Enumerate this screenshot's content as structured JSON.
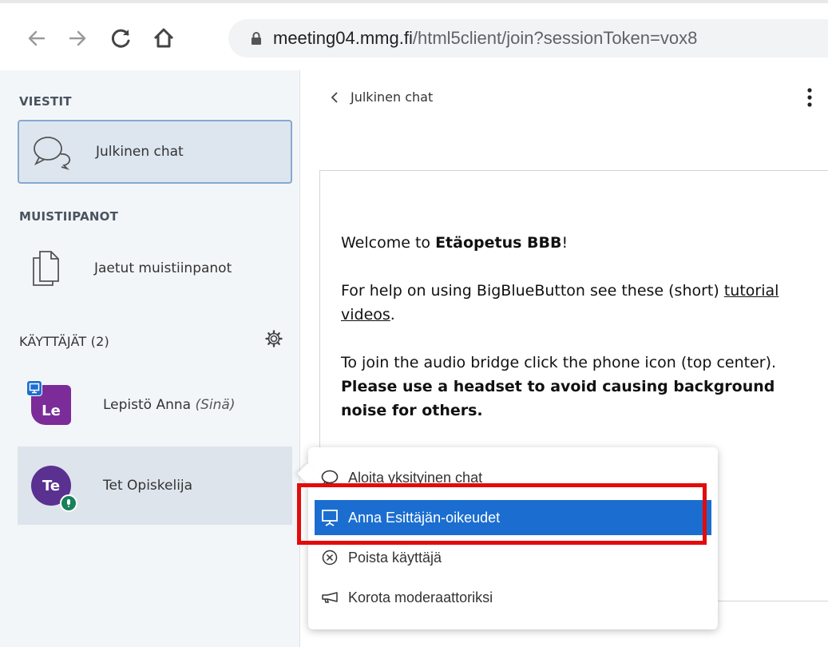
{
  "browser": {
    "url_host": "meeting04.mmg.fi",
    "url_path": "/html5client/join?sessionToken=vox8"
  },
  "sidebar": {
    "messages_title": "VIESTIT",
    "public_chat_label": "Julkinen chat",
    "notes_title": "MUISTIIPANOT",
    "shared_notes_label": "Jaetut muistiinpanot",
    "users_title": "KÄYTTÄJÄT (2)",
    "users": [
      {
        "initials": "Le",
        "name": "Lepistö Anna",
        "you_label": "(Sinä)",
        "color": "#7b2c99"
      },
      {
        "initials": "Te",
        "name": "Tet Opiskelija",
        "color": "#5a3090"
      }
    ]
  },
  "main": {
    "chat_title": "Julkinen chat",
    "welcome": {
      "line1_prefix": "Welcome to ",
      "line1_bold": "Etäopetus BBB",
      "line1_suffix": "!",
      "line2_prefix": "For help on using BigBlueButton see these (short) ",
      "line2_link": "tutorial videos",
      "line2_suffix": ".",
      "line3_prefix": "To join the audio bridge click the phone icon (top center). ",
      "line3_bold": "Please use a headset to avoid causing background noise for others."
    }
  },
  "context_menu": {
    "items": [
      {
        "label": "Aloita yksityinen chat",
        "icon": "chat-bubble-icon"
      },
      {
        "label": "Anna Esittäjän-oikeudet",
        "icon": "presentation-icon"
      },
      {
        "label": "Poista käyttäjä",
        "icon": "close-circle-icon"
      },
      {
        "label": "Korota moderaattoriksi",
        "icon": "megaphone-icon"
      }
    ]
  },
  "colors": {
    "accent": "#1b6ed0",
    "highlight": "#e30b0b",
    "sidebar_bg": "#f3f6f9"
  }
}
